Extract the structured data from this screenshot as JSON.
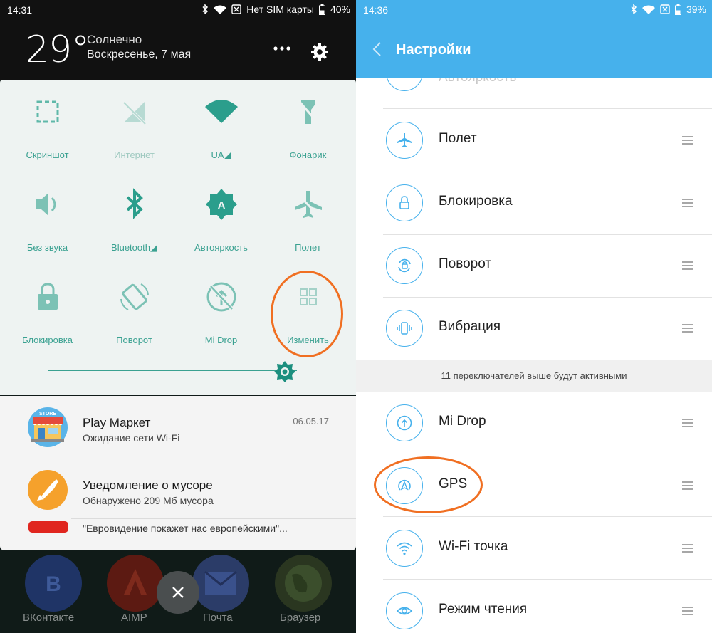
{
  "left_panel": {
    "status_bar": {
      "time": "14:31",
      "carrier": "Нет SIM карты",
      "battery": "40%"
    },
    "weather": {
      "temperature": "29°",
      "condition": "Солнечно",
      "date": "Воскресенье, 7 мая"
    },
    "quick_settings": {
      "tiles": [
        {
          "label": "Скриншот",
          "icon": "screenshot-icon",
          "active": true
        },
        {
          "label": "Интернет",
          "icon": "mobile-data-off-icon",
          "active": false
        },
        {
          "label": "UA◢",
          "icon": "wifi-icon",
          "active": true
        },
        {
          "label": "Фонарик",
          "icon": "flashlight-icon",
          "active": true
        },
        {
          "label": "Без звука",
          "icon": "volume-icon",
          "active": true
        },
        {
          "label": "Bluetooth◢",
          "icon": "bluetooth-icon",
          "active": true
        },
        {
          "label": "Автояркость",
          "icon": "auto-brightness-icon",
          "active": true
        },
        {
          "label": "Полет",
          "icon": "airplane-off-icon",
          "active": true
        },
        {
          "label": "Блокировка",
          "icon": "lock-icon",
          "active": true
        },
        {
          "label": "Поворот",
          "icon": "rotate-icon",
          "active": true
        },
        {
          "label": "Mi Drop",
          "icon": "mi-drop-off-icon",
          "active": true
        },
        {
          "label": "Изменить",
          "icon": "edit-grid-icon",
          "active": true
        }
      ],
      "brightness_level": 0.95
    },
    "notifications": [
      {
        "app": "play-market-icon",
        "title": "Play Маркет",
        "text": "Ожидание сети Wi-Fi",
        "time": "06.05.17"
      },
      {
        "app": "cleaner-icon",
        "title": "Уведомление о мусоре",
        "text": "Обнаружено 209 Мб мусора",
        "time": ""
      },
      {
        "app": "youtube-icon",
        "title": "",
        "text": "\"Евровидение покажет нас европейскими\"...",
        "time": ""
      }
    ],
    "launcher_apps": [
      "ВКонтакте",
      "AIMP",
      "Почта",
      "Браузер"
    ]
  },
  "right_panel": {
    "status_bar": {
      "time": "14:36",
      "battery": "39%"
    },
    "title": "Настройки",
    "partial_top_item": "Автояркость",
    "active_items": [
      {
        "label": "Полет",
        "icon": "airplane-icon"
      },
      {
        "label": "Блокировка",
        "icon": "lock-icon"
      },
      {
        "label": "Поворот",
        "icon": "rotate-icon"
      },
      {
        "label": "Вибрация",
        "icon": "vibration-icon"
      }
    ],
    "section_note": "11 переключателей выше будут активными",
    "inactive_items": [
      {
        "label": "Mi Drop",
        "icon": "mi-drop-icon"
      },
      {
        "label": "GPS",
        "icon": "gps-icon"
      },
      {
        "label": "Wi-Fi точка",
        "icon": "wifi-hotspot-icon"
      },
      {
        "label": "Режим чтения",
        "icon": "eye-icon"
      }
    ]
  },
  "colors": {
    "accent_teal": "#3aa191",
    "accent_blue": "#46b1ec",
    "highlight_orange": "#f06f22"
  }
}
